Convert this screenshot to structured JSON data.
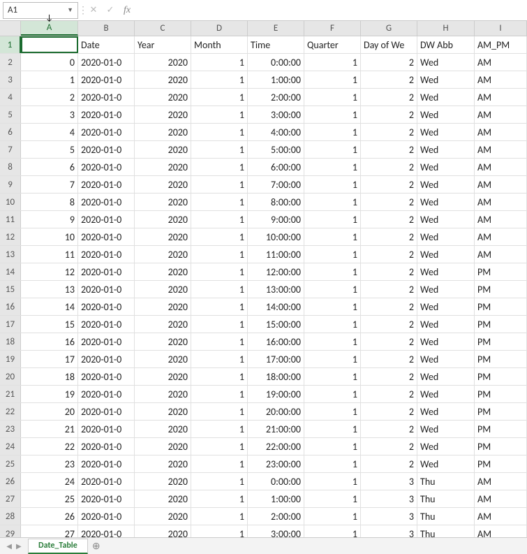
{
  "formulaBar": {
    "nameBox": "A1",
    "fx": "fx",
    "input": ""
  },
  "columns": [
    "A",
    "B",
    "C",
    "D",
    "E",
    "F",
    "G",
    "H",
    "I"
  ],
  "rowHeaders": [
    "1",
    "2",
    "3",
    "4",
    "5",
    "6",
    "7",
    "8",
    "9",
    "10",
    "11",
    "12",
    "13",
    "14",
    "15",
    "16",
    "17",
    "18",
    "19",
    "20",
    "21",
    "22",
    "23",
    "24",
    "25",
    "26",
    "27",
    "28",
    "29"
  ],
  "headerRow": [
    "",
    "Date",
    "Year",
    "Month",
    "Time",
    "Quarter",
    "Day of We",
    "DW Abb",
    "AM_PM"
  ],
  "dataRows": [
    {
      "idx": "0",
      "date": "2020-01-0",
      "year": "2020",
      "month": "1",
      "time": "0:00:00",
      "quarter": "1",
      "dow": "2",
      "dwabb": "Wed",
      "ampm": "AM"
    },
    {
      "idx": "1",
      "date": "2020-01-0",
      "year": "2020",
      "month": "1",
      "time": "1:00:00",
      "quarter": "1",
      "dow": "2",
      "dwabb": "Wed",
      "ampm": "AM"
    },
    {
      "idx": "2",
      "date": "2020-01-0",
      "year": "2020",
      "month": "1",
      "time": "2:00:00",
      "quarter": "1",
      "dow": "2",
      "dwabb": "Wed",
      "ampm": "AM"
    },
    {
      "idx": "3",
      "date": "2020-01-0",
      "year": "2020",
      "month": "1",
      "time": "3:00:00",
      "quarter": "1",
      "dow": "2",
      "dwabb": "Wed",
      "ampm": "AM"
    },
    {
      "idx": "4",
      "date": "2020-01-0",
      "year": "2020",
      "month": "1",
      "time": "4:00:00",
      "quarter": "1",
      "dow": "2",
      "dwabb": "Wed",
      "ampm": "AM"
    },
    {
      "idx": "5",
      "date": "2020-01-0",
      "year": "2020",
      "month": "1",
      "time": "5:00:00",
      "quarter": "1",
      "dow": "2",
      "dwabb": "Wed",
      "ampm": "AM"
    },
    {
      "idx": "6",
      "date": "2020-01-0",
      "year": "2020",
      "month": "1",
      "time": "6:00:00",
      "quarter": "1",
      "dow": "2",
      "dwabb": "Wed",
      "ampm": "AM"
    },
    {
      "idx": "7",
      "date": "2020-01-0",
      "year": "2020",
      "month": "1",
      "time": "7:00:00",
      "quarter": "1",
      "dow": "2",
      "dwabb": "Wed",
      "ampm": "AM"
    },
    {
      "idx": "8",
      "date": "2020-01-0",
      "year": "2020",
      "month": "1",
      "time": "8:00:00",
      "quarter": "1",
      "dow": "2",
      "dwabb": "Wed",
      "ampm": "AM"
    },
    {
      "idx": "9",
      "date": "2020-01-0",
      "year": "2020",
      "month": "1",
      "time": "9:00:00",
      "quarter": "1",
      "dow": "2",
      "dwabb": "Wed",
      "ampm": "AM"
    },
    {
      "idx": "10",
      "date": "2020-01-0",
      "year": "2020",
      "month": "1",
      "time": "10:00:00",
      "quarter": "1",
      "dow": "2",
      "dwabb": "Wed",
      "ampm": "AM"
    },
    {
      "idx": "11",
      "date": "2020-01-0",
      "year": "2020",
      "month": "1",
      "time": "11:00:00",
      "quarter": "1",
      "dow": "2",
      "dwabb": "Wed",
      "ampm": "AM"
    },
    {
      "idx": "12",
      "date": "2020-01-0",
      "year": "2020",
      "month": "1",
      "time": "12:00:00",
      "quarter": "1",
      "dow": "2",
      "dwabb": "Wed",
      "ampm": "PM"
    },
    {
      "idx": "13",
      "date": "2020-01-0",
      "year": "2020",
      "month": "1",
      "time": "13:00:00",
      "quarter": "1",
      "dow": "2",
      "dwabb": "Wed",
      "ampm": "PM"
    },
    {
      "idx": "14",
      "date": "2020-01-0",
      "year": "2020",
      "month": "1",
      "time": "14:00:00",
      "quarter": "1",
      "dow": "2",
      "dwabb": "Wed",
      "ampm": "PM"
    },
    {
      "idx": "15",
      "date": "2020-01-0",
      "year": "2020",
      "month": "1",
      "time": "15:00:00",
      "quarter": "1",
      "dow": "2",
      "dwabb": "Wed",
      "ampm": "PM"
    },
    {
      "idx": "16",
      "date": "2020-01-0",
      "year": "2020",
      "month": "1",
      "time": "16:00:00",
      "quarter": "1",
      "dow": "2",
      "dwabb": "Wed",
      "ampm": "PM"
    },
    {
      "idx": "17",
      "date": "2020-01-0",
      "year": "2020",
      "month": "1",
      "time": "17:00:00",
      "quarter": "1",
      "dow": "2",
      "dwabb": "Wed",
      "ampm": "PM"
    },
    {
      "idx": "18",
      "date": "2020-01-0",
      "year": "2020",
      "month": "1",
      "time": "18:00:00",
      "quarter": "1",
      "dow": "2",
      "dwabb": "Wed",
      "ampm": "PM"
    },
    {
      "idx": "19",
      "date": "2020-01-0",
      "year": "2020",
      "month": "1",
      "time": "19:00:00",
      "quarter": "1",
      "dow": "2",
      "dwabb": "Wed",
      "ampm": "PM"
    },
    {
      "idx": "20",
      "date": "2020-01-0",
      "year": "2020",
      "month": "1",
      "time": "20:00:00",
      "quarter": "1",
      "dow": "2",
      "dwabb": "Wed",
      "ampm": "PM"
    },
    {
      "idx": "21",
      "date": "2020-01-0",
      "year": "2020",
      "month": "1",
      "time": "21:00:00",
      "quarter": "1",
      "dow": "2",
      "dwabb": "Wed",
      "ampm": "PM"
    },
    {
      "idx": "22",
      "date": "2020-01-0",
      "year": "2020",
      "month": "1",
      "time": "22:00:00",
      "quarter": "1",
      "dow": "2",
      "dwabb": "Wed",
      "ampm": "PM"
    },
    {
      "idx": "23",
      "date": "2020-01-0",
      "year": "2020",
      "month": "1",
      "time": "23:00:00",
      "quarter": "1",
      "dow": "2",
      "dwabb": "Wed",
      "ampm": "PM"
    },
    {
      "idx": "24",
      "date": "2020-01-0",
      "year": "2020",
      "month": "1",
      "time": "0:00:00",
      "quarter": "1",
      "dow": "3",
      "dwabb": "Thu",
      "ampm": "AM"
    },
    {
      "idx": "25",
      "date": "2020-01-0",
      "year": "2020",
      "month": "1",
      "time": "1:00:00",
      "quarter": "1",
      "dow": "3",
      "dwabb": "Thu",
      "ampm": "AM"
    },
    {
      "idx": "26",
      "date": "2020-01-0",
      "year": "2020",
      "month": "1",
      "time": "2:00:00",
      "quarter": "1",
      "dow": "3",
      "dwabb": "Thu",
      "ampm": "AM"
    },
    {
      "idx": "27",
      "date": "2020-01-0",
      "year": "2020",
      "month": "1",
      "time": "3:00:00",
      "quarter": "1",
      "dow": "3",
      "dwabb": "Thu",
      "ampm": "AM"
    }
  ],
  "sheetTab": "Date_Table"
}
